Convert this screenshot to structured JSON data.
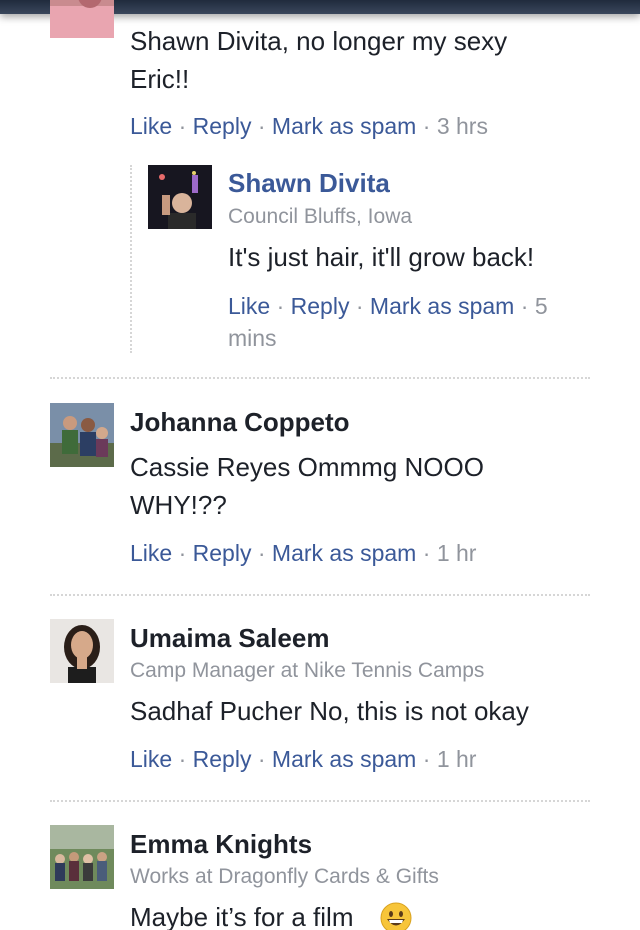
{
  "comments": [
    {
      "text": "Shawn Divita, no longer my sexy Eric!!",
      "actions": {
        "like": "Like",
        "reply": "Reply",
        "spam": "Mark as spam",
        "time": "3 hrs"
      }
    },
    {
      "name": "Shawn Divita",
      "subtitle": "Council Bluffs, Iowa",
      "text": "It's just hair, it'll grow back!",
      "actions": {
        "like": "Like",
        "reply": "Reply",
        "spam": "Mark as spam",
        "time": "5 mins"
      }
    },
    {
      "name": "Johanna Coppeto",
      "text": "Cassie Reyes Ommmg NOOO WHY!??",
      "actions": {
        "like": "Like",
        "reply": "Reply",
        "spam": "Mark as spam",
        "time": "1 hr"
      }
    },
    {
      "name": "Umaima Saleem",
      "subtitle": "Camp Manager at Nike Tennis Camps",
      "text": "Sadhaf Pucher No, this is not okay",
      "actions": {
        "like": "Like",
        "reply": "Reply",
        "spam": "Mark as spam",
        "time": "1 hr"
      }
    },
    {
      "name": "Emma Knights",
      "subtitle": "Works at Dragonfly Cards & Gifts",
      "text": "Maybe it’s for a film",
      "emoji": "grinning-face-emoji"
    }
  ],
  "separator": "·",
  "colors": {
    "link": "#3b5998",
    "meta": "#90949c",
    "text": "#1d2129",
    "divider": "#d6d6d6"
  }
}
